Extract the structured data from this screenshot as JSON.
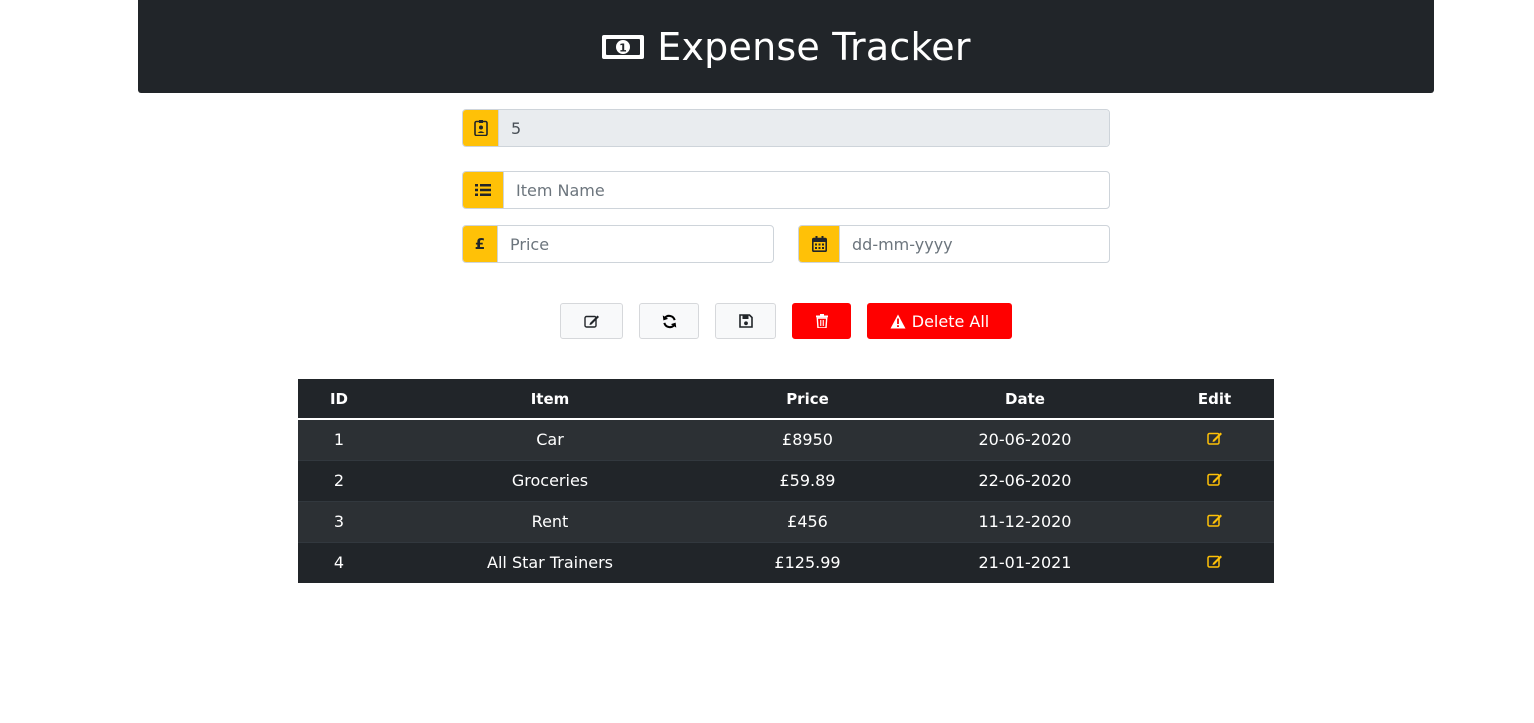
{
  "header": {
    "title": "Expense Tracker",
    "icon": "money-bill-icon"
  },
  "form": {
    "id_field": {
      "value": "5",
      "icon": "id-badge-icon"
    },
    "item_name": {
      "placeholder": "Item Name",
      "icon": "list-icon"
    },
    "price": {
      "placeholder": "Price",
      "addon_symbol": "£"
    },
    "date": {
      "placeholder": "dd-mm-yyyy",
      "icon": "calendar-icon"
    }
  },
  "toolbar": {
    "edit_icon": "edit-icon",
    "refresh_icon": "sync-icon",
    "save_icon": "save-icon",
    "delete_icon": "trash-icon",
    "delete_all_label": "Delete All",
    "delete_all_icon": "warning-icon"
  },
  "table": {
    "columns": [
      "ID",
      "Item",
      "Price",
      "Date",
      "Edit"
    ],
    "rows": [
      {
        "id": "1",
        "item": "Car",
        "price": "£8950",
        "date": "20-06-2020"
      },
      {
        "id": "2",
        "item": "Groceries",
        "price": "£59.89",
        "date": "22-06-2020"
      },
      {
        "id": "3",
        "item": "Rent",
        "price": "£456",
        "date": "11-12-2020"
      },
      {
        "id": "4",
        "item": "All Star Trainers",
        "price": "£125.99",
        "date": "21-01-2021"
      }
    ]
  },
  "colors": {
    "header_bg": "#212529",
    "accent": "#ffc107",
    "danger": "#ff0000",
    "table_odd": "#2c3034",
    "table_even": "#212529"
  }
}
